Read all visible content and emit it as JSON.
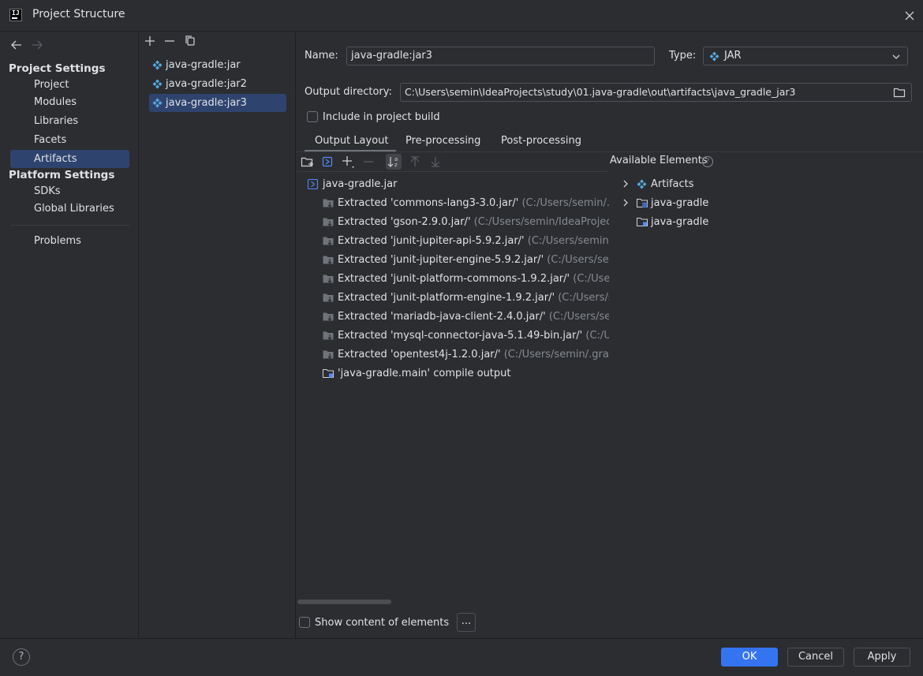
{
  "window": {
    "title": "Project Structure"
  },
  "sidebar": {
    "project_settings_header": "Project Settings",
    "project_items": [
      "Project",
      "Modules",
      "Libraries",
      "Facets",
      "Artifacts"
    ],
    "platform_settings_header": "Platform Settings",
    "platform_items": [
      "SDKs",
      "Global Libraries"
    ],
    "problems_label": "Problems",
    "selected": "Artifacts"
  },
  "artifacts": {
    "items": [
      "java-gradle:jar",
      "java-gradle:jar2",
      "java-gradle:jar3"
    ],
    "selected": "java-gradle:jar3"
  },
  "form": {
    "name_label": "Name:",
    "name_value": "java-gradle:jar3",
    "type_label": "Type:",
    "type_value": "JAR",
    "output_dir_label": "Output directory:",
    "output_dir_value": "C:\\Users\\semin\\IdeaProjects\\study\\01.java-gradle\\out\\artifacts\\java_gradle_jar3",
    "include_build_label": "Include in project build",
    "include_build_checked": false
  },
  "tabs": [
    "Output Layout",
    "Pre-processing",
    "Post-processing"
  ],
  "active_tab": "Output Layout",
  "layout_tree": {
    "root": "java-gradle.jar",
    "children": [
      {
        "name": "Extracted 'commons-lang3-3.0.jar/'",
        "path": "(C:/Users/semin/.g"
      },
      {
        "name": "Extracted 'gson-2.9.0.jar/'",
        "path": "(C:/Users/semin/IdeaProject"
      },
      {
        "name": "Extracted 'junit-jupiter-api-5.9.2.jar/'",
        "path": "(C:/Users/semin/."
      },
      {
        "name": "Extracted 'junit-jupiter-engine-5.9.2.jar/'",
        "path": "(C:/Users/sem"
      },
      {
        "name": "Extracted 'junit-platform-commons-1.9.2.jar/'",
        "path": "(C:/Users"
      },
      {
        "name": "Extracted 'junit-platform-engine-1.9.2.jar/'",
        "path": "(C:/Users/se"
      },
      {
        "name": "Extracted 'mariadb-java-client-2.4.0.jar/'",
        "path": "(C:/Users/sem"
      },
      {
        "name": "Extracted 'mysql-connector-java-5.1.49-bin.jar/'",
        "path": "(C:/Us"
      },
      {
        "name": "Extracted 'opentest4j-1.2.0.jar/'",
        "path": "(C:/Users/semin/.gradl"
      },
      {
        "name": "'java-gradle.main' compile output",
        "path": ""
      }
    ]
  },
  "available": {
    "header": "Available Elements",
    "items": [
      "Artifacts",
      "java-gradle",
      "java-gradle"
    ]
  },
  "show_content_label": "Show content of elements",
  "show_content_checked": false,
  "ellipsis_label": "...",
  "footer": {
    "help": "?",
    "ok": "OK",
    "cancel": "Cancel",
    "apply": "Apply"
  },
  "colors": {
    "background": "#2b2d30",
    "selection": "#2e436e",
    "primary_button": "#3574f0",
    "text": "#dfe1e5",
    "muted_text": "#868a91"
  }
}
